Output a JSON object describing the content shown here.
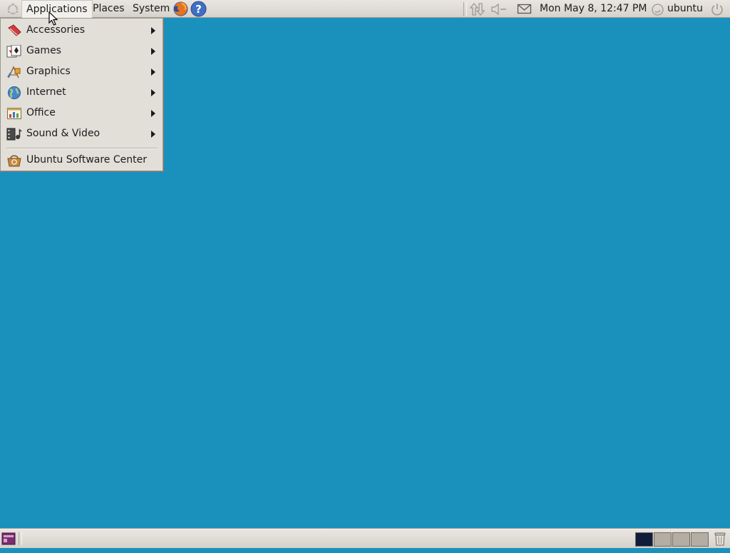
{
  "top_panel": {
    "menus": [
      "Applications",
      "Places",
      "System"
    ],
    "launchers": [
      "firefox-icon",
      "help-icon"
    ],
    "indicators": [
      "network-icon",
      "volume-icon",
      "mail-icon"
    ],
    "clock": "Mon May  8, 12:47 PM",
    "user": "ubuntu",
    "shutdown_icon": "power-icon"
  },
  "applications_menu": {
    "items": [
      {
        "label": "Accessories",
        "icon": "accessories-icon",
        "submenu": true
      },
      {
        "label": "Games",
        "icon": "games-icon",
        "submenu": true
      },
      {
        "label": "Graphics",
        "icon": "graphics-icon",
        "submenu": true
      },
      {
        "label": "Internet",
        "icon": "internet-icon",
        "submenu": true
      },
      {
        "label": "Office",
        "icon": "office-icon",
        "submenu": true
      },
      {
        "label": "Sound & Video",
        "icon": "sound-video-icon",
        "submenu": true
      }
    ],
    "footer_item": {
      "label": "Ubuntu Software Center",
      "icon": "software-center-icon"
    }
  },
  "desktop": {
    "background_color": "#1a91bd"
  },
  "bottom_panel": {
    "show_desktop_icon": "show-desktop-icon",
    "workspaces": 4,
    "active_workspace": 1,
    "trash_icon": "trash-icon"
  }
}
